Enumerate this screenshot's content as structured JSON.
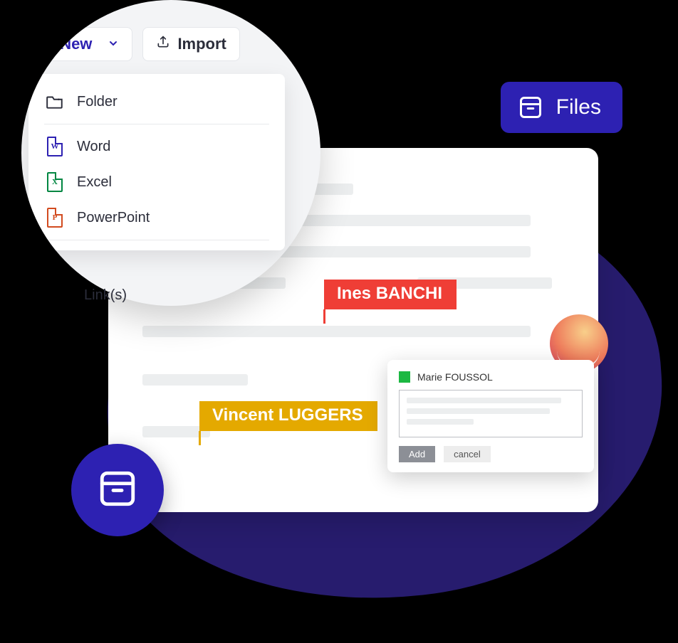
{
  "badge": {
    "label": "Files"
  },
  "toolbar": {
    "new_label": "New",
    "import_label": "Import"
  },
  "new_menu": {
    "folder": "Folder",
    "word": "Word",
    "excel": "Excel",
    "powerpoint": "PowerPoint",
    "links": "Link(s)"
  },
  "labels": {
    "ines": "Ines BANCHI",
    "vincent": "Vincent LUGGERS"
  },
  "comment": {
    "user": "Marie FOUSSOL",
    "add": "Add",
    "cancel": "cancel"
  },
  "colors": {
    "primary": "#2D21B2",
    "red": "#EF3E36",
    "yellow": "#E4A900",
    "green": "#1CB842"
  }
}
